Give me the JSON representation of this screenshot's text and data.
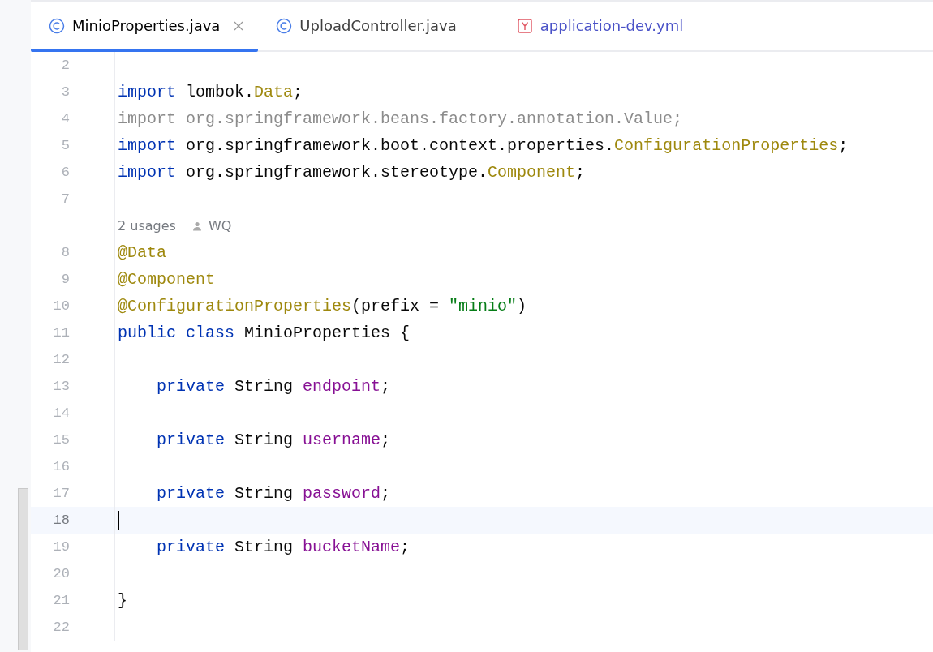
{
  "tabs": [
    {
      "label": "MinioProperties.java",
      "kind": "class",
      "selected": true
    },
    {
      "label": "UploadController.java",
      "kind": "class",
      "selected": false
    },
    {
      "label": "application-dev.yml",
      "kind": "yaml",
      "selected": false
    }
  ],
  "editor": {
    "lines": [
      {
        "kind": "code",
        "number": "2",
        "current": false
      },
      {
        "kind": "code",
        "number": "3",
        "current": false,
        "tokens": [
          {
            "text": "import",
            "kind": "keyword"
          },
          {
            "text": " lombok.",
            "kind": "plain"
          },
          {
            "text": "Data",
            "kind": "type"
          },
          {
            "text": ";",
            "kind": "plain"
          }
        ]
      },
      {
        "kind": "code",
        "number": "4",
        "current": false,
        "tokens": [
          {
            "text": "import org.springframework.beans.factory.annotation.Value;",
            "kind": "unused"
          }
        ]
      },
      {
        "kind": "code",
        "number": "5",
        "current": false,
        "tokens": [
          {
            "text": "import",
            "kind": "keyword"
          },
          {
            "text": " org.springframework.boot.context.properties.",
            "kind": "plain"
          },
          {
            "text": "ConfigurationProperties",
            "kind": "type"
          },
          {
            "text": ";",
            "kind": "plain"
          }
        ]
      },
      {
        "kind": "code",
        "number": "6",
        "current": false,
        "tokens": [
          {
            "text": "import",
            "kind": "keyword"
          },
          {
            "text": " org.springframework.stereotype.",
            "kind": "plain"
          },
          {
            "text": "Component",
            "kind": "type"
          },
          {
            "text": ";",
            "kind": "plain"
          }
        ]
      },
      {
        "kind": "code",
        "number": "7",
        "current": false
      },
      {
        "kind": "hint",
        "usages": "2 usages",
        "author": "WQ"
      },
      {
        "kind": "code",
        "number": "8",
        "current": false,
        "tokens": [
          {
            "text": "@Data",
            "kind": "annotation"
          }
        ]
      },
      {
        "kind": "code",
        "number": "9",
        "current": false,
        "tokens": [
          {
            "text": "@Component",
            "kind": "annotation"
          }
        ]
      },
      {
        "kind": "code",
        "number": "10",
        "current": false,
        "tokens": [
          {
            "text": "@ConfigurationProperties",
            "kind": "annotation"
          },
          {
            "text": "(prefix = ",
            "kind": "plain"
          },
          {
            "text": "\"minio\"",
            "kind": "string"
          },
          {
            "text": ")",
            "kind": "plain"
          }
        ]
      },
      {
        "kind": "code",
        "number": "11",
        "current": false,
        "tokens": [
          {
            "text": "public class",
            "kind": "keyword"
          },
          {
            "text": " MinioProperties {",
            "kind": "plain"
          }
        ]
      },
      {
        "kind": "code",
        "number": "12",
        "current": false
      },
      {
        "kind": "code",
        "number": "13",
        "current": false,
        "tokens": [
          {
            "text": "    private",
            "kind": "keyword"
          },
          {
            "text": " String ",
            "kind": "plain"
          },
          {
            "text": "endpoint",
            "kind": "field"
          },
          {
            "text": ";",
            "kind": "plain"
          }
        ]
      },
      {
        "kind": "code",
        "number": "14",
        "current": false
      },
      {
        "kind": "code",
        "number": "15",
        "current": false,
        "tokens": [
          {
            "text": "    private",
            "kind": "keyword"
          },
          {
            "text": " String ",
            "kind": "plain"
          },
          {
            "text": "username",
            "kind": "field"
          },
          {
            "text": ";",
            "kind": "plain"
          }
        ]
      },
      {
        "kind": "code",
        "number": "16",
        "current": false
      },
      {
        "kind": "code",
        "number": "17",
        "current": false,
        "tokens": [
          {
            "text": "    private",
            "kind": "keyword"
          },
          {
            "text": " String ",
            "kind": "plain"
          },
          {
            "text": "password",
            "kind": "field"
          },
          {
            "text": ";",
            "kind": "plain"
          }
        ]
      },
      {
        "kind": "code",
        "number": "18",
        "current": true
      },
      {
        "kind": "code",
        "number": "19",
        "current": false,
        "tokens": [
          {
            "text": "    private",
            "kind": "keyword"
          },
          {
            "text": " String ",
            "kind": "plain"
          },
          {
            "text": "bucketName",
            "kind": "field"
          },
          {
            "text": ";",
            "kind": "plain"
          }
        ]
      },
      {
        "kind": "code",
        "number": "20",
        "current": false
      },
      {
        "kind": "code",
        "number": "21",
        "current": false,
        "tokens": [
          {
            "text": "}",
            "kind": "plain"
          }
        ]
      },
      {
        "kind": "code",
        "number": "22",
        "current": false
      }
    ]
  }
}
